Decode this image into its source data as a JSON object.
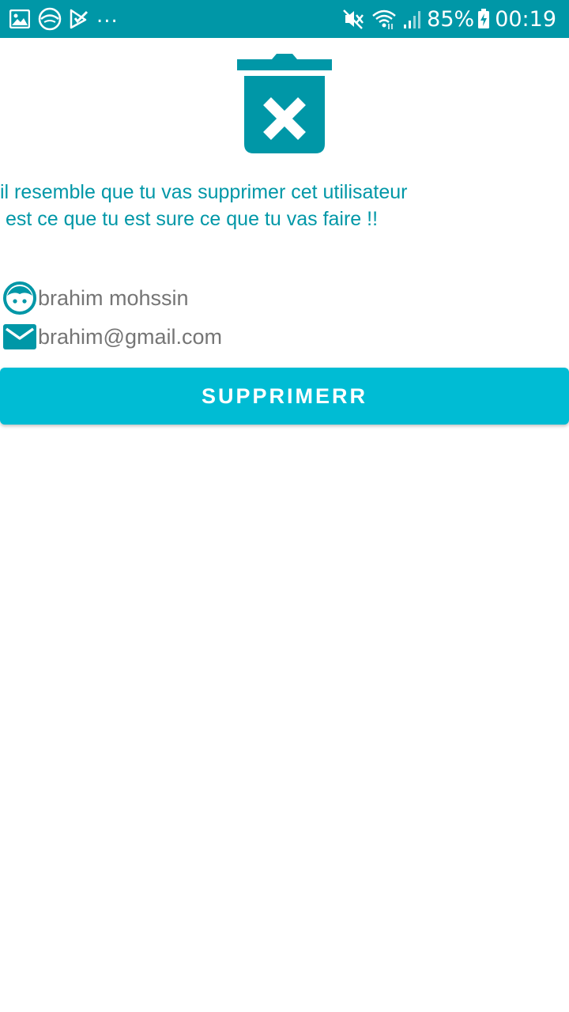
{
  "status_bar": {
    "left_icons": [
      "gallery-icon",
      "app-logo-icon",
      "checklist-icon"
    ],
    "overflow": "...",
    "right_icons": [
      "mute-icon",
      "wifi-icon",
      "signal-icon"
    ],
    "battery": "85%",
    "time": "00:19",
    "background": "#0097a7"
  },
  "header_icon": "trash-delete-icon",
  "warning": {
    "line1": "il resemble que tu vas supprimer cet utilisateur",
    "line2": " est ce que tu est sure ce que tu vas faire !!",
    "color": "#0097a7"
  },
  "user": {
    "name": "brahim mohssin",
    "name_icon": "person-face-icon",
    "email": "brahim@gmail.com",
    "email_icon": "mail-icon"
  },
  "button": {
    "label": "SUPPRIMERR",
    "color": "#00bcd4"
  }
}
